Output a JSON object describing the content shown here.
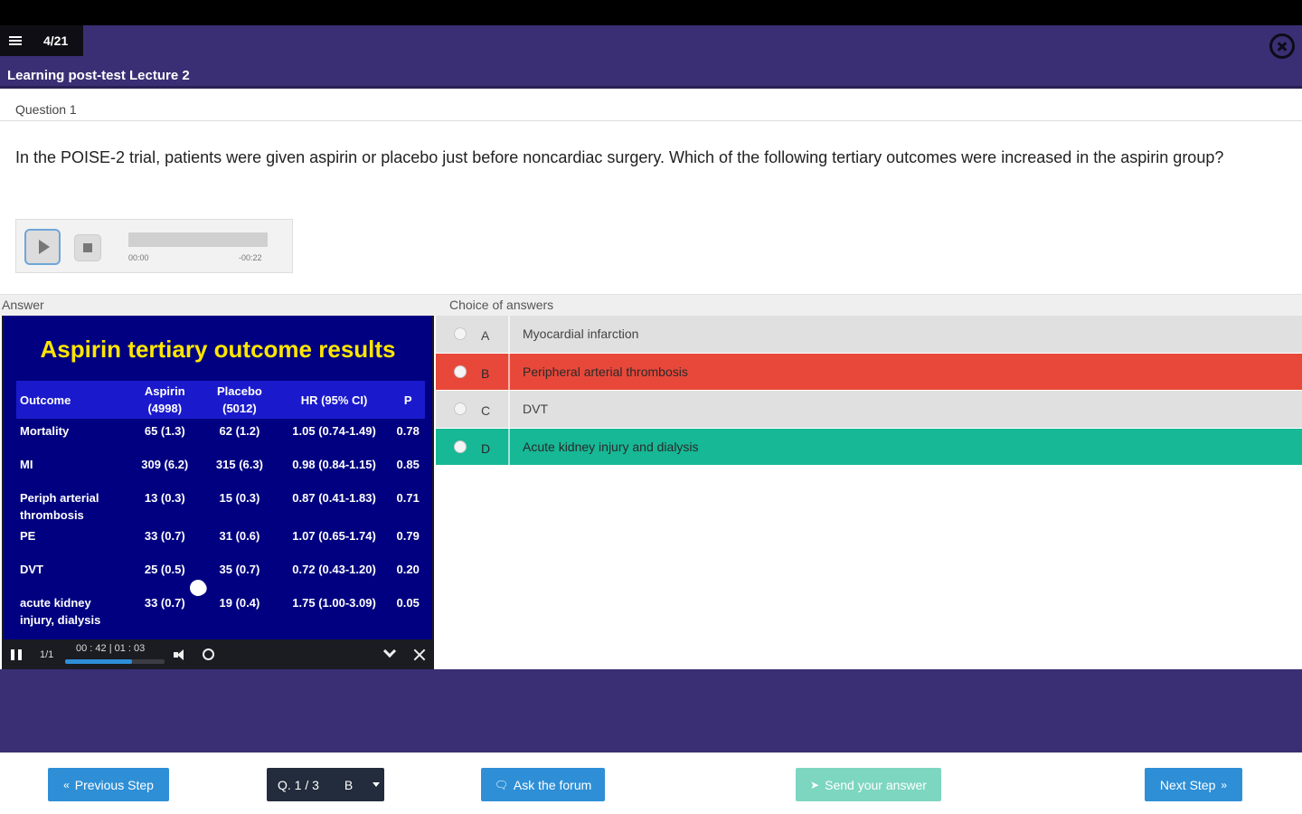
{
  "header": {
    "progress": "4/21",
    "lecture_title": "Learning post-test Lecture 2",
    "background": "#3a2f74"
  },
  "question": {
    "label": "Question 1",
    "text": "In the POISE-2 trial, patients were given aspirin or placebo just before noncardiac surgery. Which of the following tertiary outcomes were increased in the aspirin group?"
  },
  "audio": {
    "start_time": "00:00",
    "remaining_time": "-00:22"
  },
  "answer_section": {
    "answer_label": "Answer",
    "choices_label": "Choice of answers"
  },
  "slide": {
    "title": "Aspirin tertiary outcome results",
    "title_color": "#ffe600",
    "columns": [
      "Outcome",
      "Aspirin (4998)",
      "Placebo (5012)",
      "HR (95% CI)",
      "P"
    ],
    "rows": [
      {
        "outcome": "Mortality",
        "aspirin": "65 (1.3)",
        "placebo": "62 (1.2)",
        "hr": "1.05 (0.74-1.49)",
        "p": "0.78"
      },
      {
        "outcome": "MI",
        "aspirin": "309 (6.2)",
        "placebo": "315 (6.3)",
        "hr": "0.98 (0.84-1.15)",
        "p": "0.85"
      },
      {
        "outcome": "Periph arterial thrombosis",
        "aspirin": "13 (0.3)",
        "placebo": "15 (0.3)",
        "hr": "0.87 (0.41-1.83)",
        "p": "0.71"
      },
      {
        "outcome": "PE",
        "aspirin": "33 (0.7)",
        "placebo": "31 (0.6)",
        "hr": "1.07 (0.65-1.74)",
        "p": "0.79"
      },
      {
        "outcome": "DVT",
        "aspirin": "25 (0.5)",
        "placebo": "35 (0.7)",
        "hr": "0.72 (0.43-1.20)",
        "p": "0.20"
      },
      {
        "outcome": "acute kidney injury, dialysis",
        "aspirin": "33 (0.7)",
        "placebo": "19 (0.4)",
        "hr": "1.75 (1.00-3.09)",
        "p": "0.05"
      }
    ]
  },
  "player": {
    "page": "1/1",
    "time": "00 : 42 | 01 : 03",
    "progress_fraction": 0.67
  },
  "choices": [
    {
      "letter": "A",
      "text": "Myocardial infarction",
      "state": "neutral",
      "color": "#e0e0e0"
    },
    {
      "letter": "B",
      "text": "Peripheral arterial thrombosis",
      "state": "wrong",
      "color": "#e8483a"
    },
    {
      "letter": "C",
      "text": "DVT",
      "state": "neutral",
      "color": "#e0e0e0"
    },
    {
      "letter": "D",
      "text": "Acute kidney injury and dialysis",
      "state": "correct",
      "color": "#17b896"
    }
  ],
  "footer": {
    "previous_label": "Previous Step",
    "selector_question": "Q. 1 / 3",
    "selector_value": "B",
    "forum_label": "Ask the forum",
    "send_label": "Send your answer",
    "next_label": "Next Step"
  }
}
